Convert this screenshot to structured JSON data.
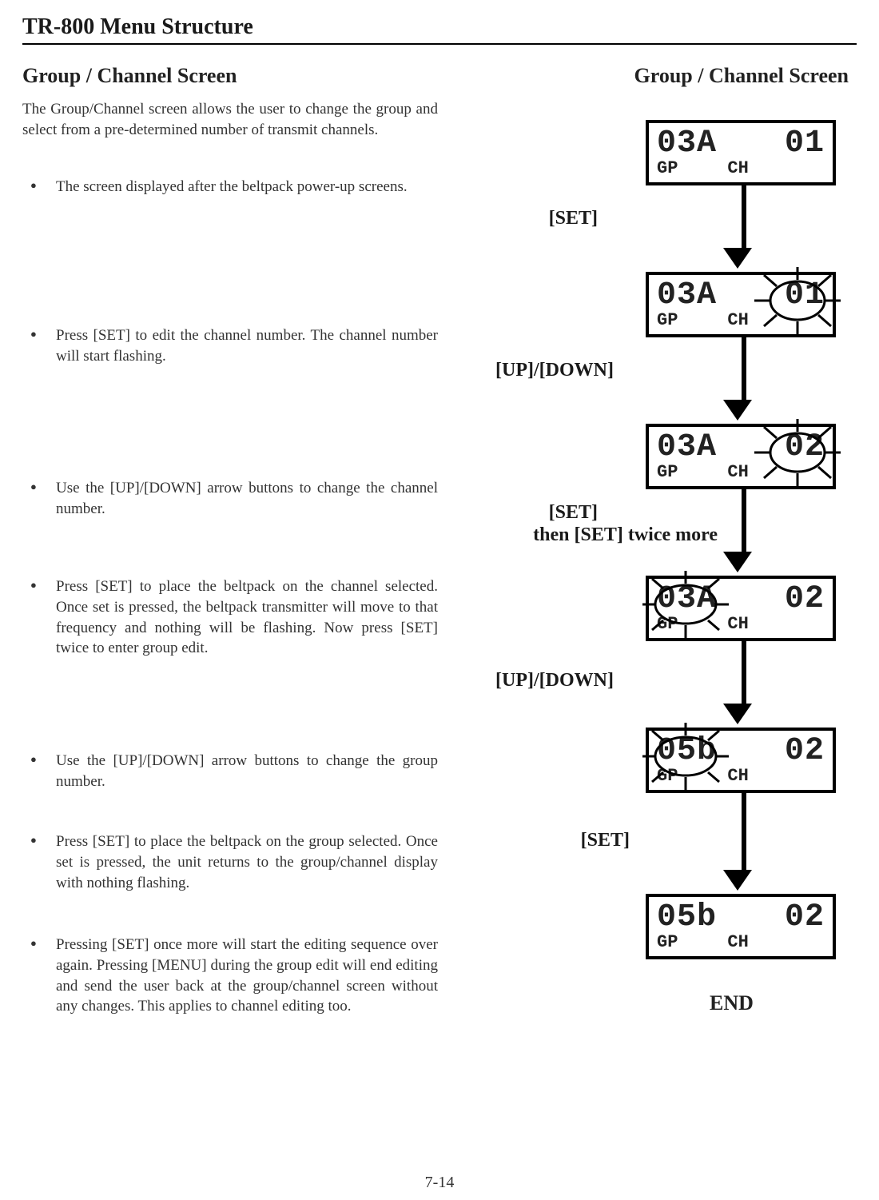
{
  "header": "TR-800 Menu Structure",
  "page_no": "7-14",
  "left": {
    "title": "Group / Channel Screen",
    "intro": "The Group/Channel screen allows the user to change the group and select from a pre-determined number of transmit channels.",
    "b1": "The screen displayed after the beltpack power-up screens.",
    "b2": "Press [SET] to edit the channel number. The channel number will start flashing.",
    "b3": "Use the [UP]/[DOWN] arrow buttons to change the channel number.",
    "b4": "Press [SET] to place the beltpack on the channel selected. Once set is pressed, the beltpack transmitter will move to that frequency and nothing will be flashing. Now press [SET] twice to enter group edit.",
    "b5": "Use the [UP]/[DOWN] arrow buttons to change the group number.",
    "b6": "Press [SET] to place the beltpack on the group selected. Once set is pressed, the unit returns to the group/channel display with nothing flashing.",
    "b7": "Pressing [SET] once more will start the editing sequence over again. Pressing [MENU] during the group edit will end editing and send the user back at the group/channel screen without any changes. This applies to channel editing too."
  },
  "right": {
    "title": "Group / Channel Screen",
    "step1_lbl": "[SET]",
    "step2_lbl": "[UP]/[DOWN]",
    "step3_lbl_a": "[SET]",
    "step3_lbl_b": "then [SET] twice more",
    "step4_lbl": "[UP]/[DOWN]",
    "step5_lbl": "[SET]",
    "end": "END"
  },
  "lcd": {
    "gp": "GP",
    "ch": "CH",
    "s1": {
      "g": "03A",
      "c": "01"
    },
    "s2": {
      "g": "03A",
      "c": "01"
    },
    "s3": {
      "g": "03A",
      "c": "02"
    },
    "s4": {
      "g": "03A",
      "c": "02"
    },
    "s5": {
      "g": "05b",
      "c": "02"
    },
    "s6": {
      "g": "05b",
      "c": "02"
    }
  }
}
